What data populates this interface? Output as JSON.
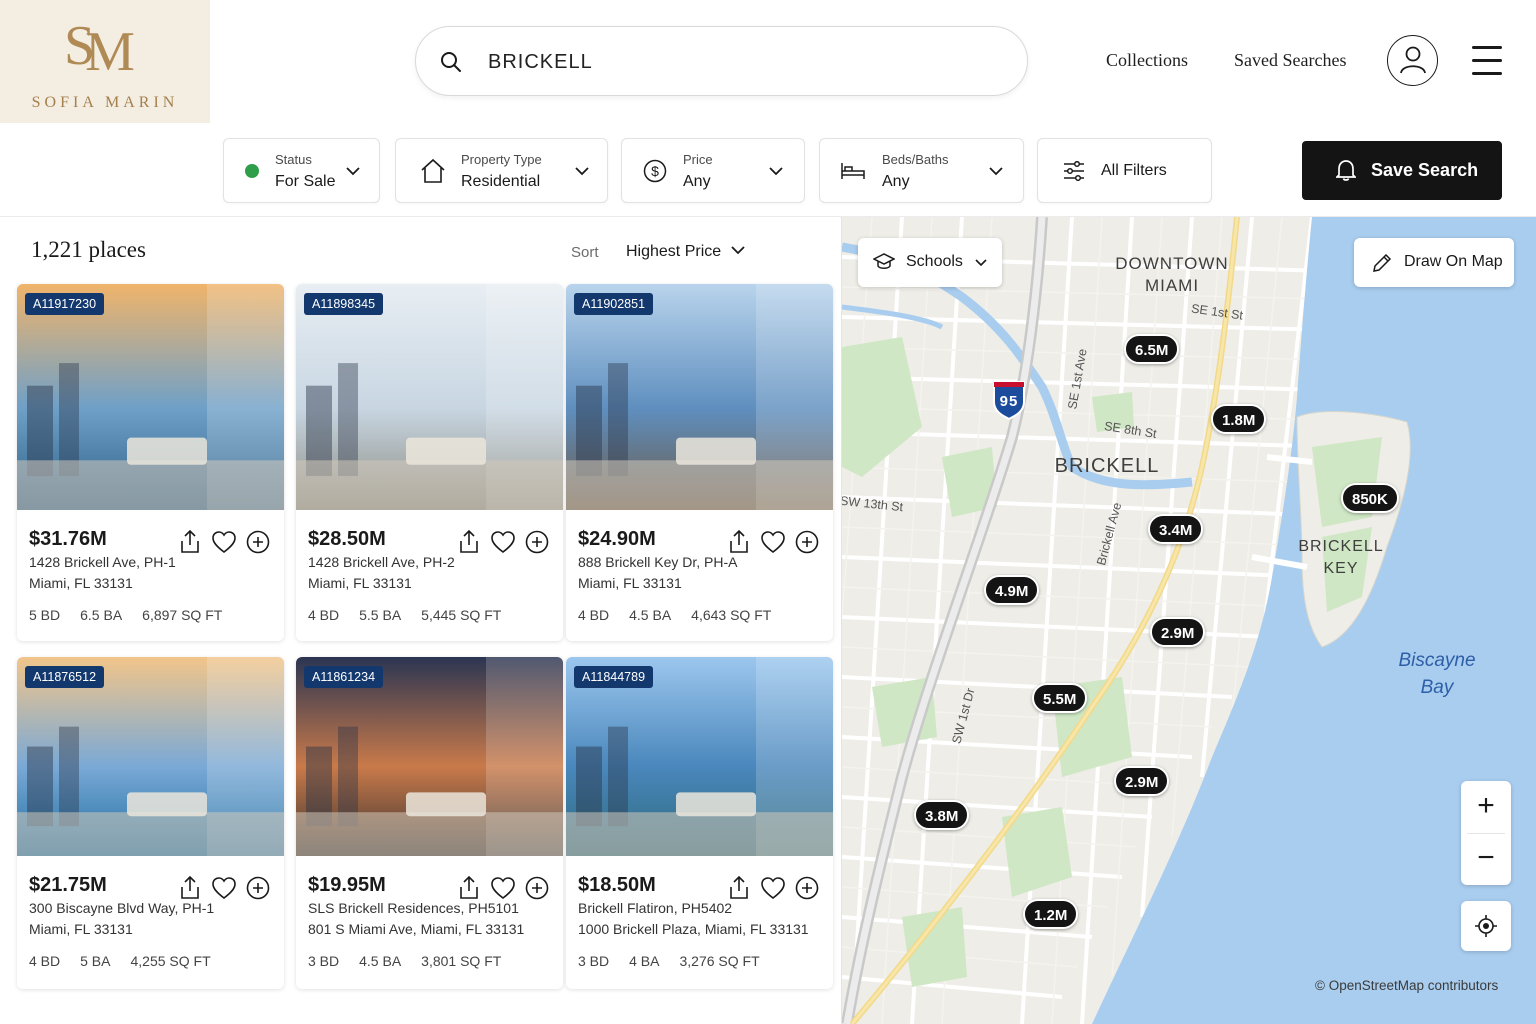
{
  "brand": {
    "monogram_s": "S",
    "monogram_m": "M",
    "name": "SOFIA MARIN",
    "color": "#b08a55"
  },
  "search": {
    "value": "BRICKELL",
    "icon": "search-icon"
  },
  "nav": {
    "collections": "Collections",
    "saved_searches": "Saved Searches",
    "account_icon": "user-icon",
    "menu_icon": "hamburger-icon"
  },
  "filters": {
    "status": {
      "label": "Status",
      "value": "For Sale",
      "dot_color": "#2e9e4b"
    },
    "property_type": {
      "label": "Property Type",
      "value": "Residential",
      "icon": "home-icon"
    },
    "price": {
      "label": "Price",
      "value": "Any",
      "icon": "dollar-icon"
    },
    "beds_baths": {
      "label": "Beds/Baths",
      "value": "Any",
      "icon": "bed-icon"
    },
    "all_filters": {
      "label": "All Filters",
      "icon": "sliders-icon"
    },
    "save_search": {
      "label": "Save Search",
      "icon": "bell-icon"
    }
  },
  "results": {
    "count": "1,221 places",
    "sort_label": "Sort",
    "sort_value": "Highest Price"
  },
  "listings": [
    {
      "mls": "A11917230",
      "price": "$31.76M",
      "address1": "1428 Brickell Ave, PH-1",
      "address2": "Miami, FL 33131",
      "beds": "5 BD",
      "baths": "6.5 BA",
      "sqft": "6,897 SQ FT"
    },
    {
      "mls": "A11898345",
      "price": "$28.50M",
      "address1": "1428 Brickell Ave, PH-2",
      "address2": "Miami, FL 33131",
      "beds": "4 BD",
      "baths": "5.5 BA",
      "sqft": "5,445 SQ FT"
    },
    {
      "mls": "A11902851",
      "price": "$24.90M",
      "address1": "888 Brickell Key Dr, PH-A",
      "address2": "Miami, FL 33131",
      "beds": "4 BD",
      "baths": "4.5 BA",
      "sqft": "4,643 SQ FT"
    },
    {
      "mls": "A11876512",
      "price": "$21.75M",
      "address1": "300 Biscayne Blvd Way, PH-1",
      "address2": "Miami, FL 33131",
      "beds": "4 BD",
      "baths": "5 BA",
      "sqft": "4,255 SQ FT"
    },
    {
      "mls": "A11861234",
      "price": "$19.95M",
      "address1": "SLS Brickell Residences, PH5101",
      "address2": "801 S Miami Ave, Miami, FL 33131",
      "beds": "3 BD",
      "baths": "4.5 BA",
      "sqft": "3,801 SQ FT"
    },
    {
      "mls": "A11844789",
      "price": "$18.50M",
      "address1": "Brickell Flatiron, PH5402",
      "address2": "1000 Brickell Plaza, Miami, FL 33131",
      "beds": "3 BD",
      "baths": "4 BA",
      "sqft": "3,276 SQ FT"
    }
  ],
  "map": {
    "schools": "Schools",
    "draw": "Draw On Map",
    "labels": {
      "downtown": "DOWNTOWN MIAMI",
      "brickell": "BRICKELL",
      "brickell_key": "BRICKELL KEY",
      "biscayne_bay": "Biscayne Bay",
      "interstate": "95"
    },
    "streets": {
      "se1st": "SE 1st St",
      "se1ave": "SE 1st Ave",
      "se8th": "SE 8th St",
      "sw13th": "SW 13th St",
      "brickell_ave": "Brickell Ave",
      "sw1st_dr": "SW 1st Dr"
    },
    "pins": [
      "6.5M",
      "1.8M",
      "850K",
      "3.4M",
      "4.9M",
      "2.9M",
      "5.5M",
      "2.9M",
      "3.8M",
      "1.2M"
    ],
    "zoom_in": "+",
    "zoom_out": "−",
    "attribution": "© OpenStreetMap contributors",
    "water_color": "#a9cdef",
    "land_color": "#eeede7",
    "park_color": "#cfe7c4"
  }
}
